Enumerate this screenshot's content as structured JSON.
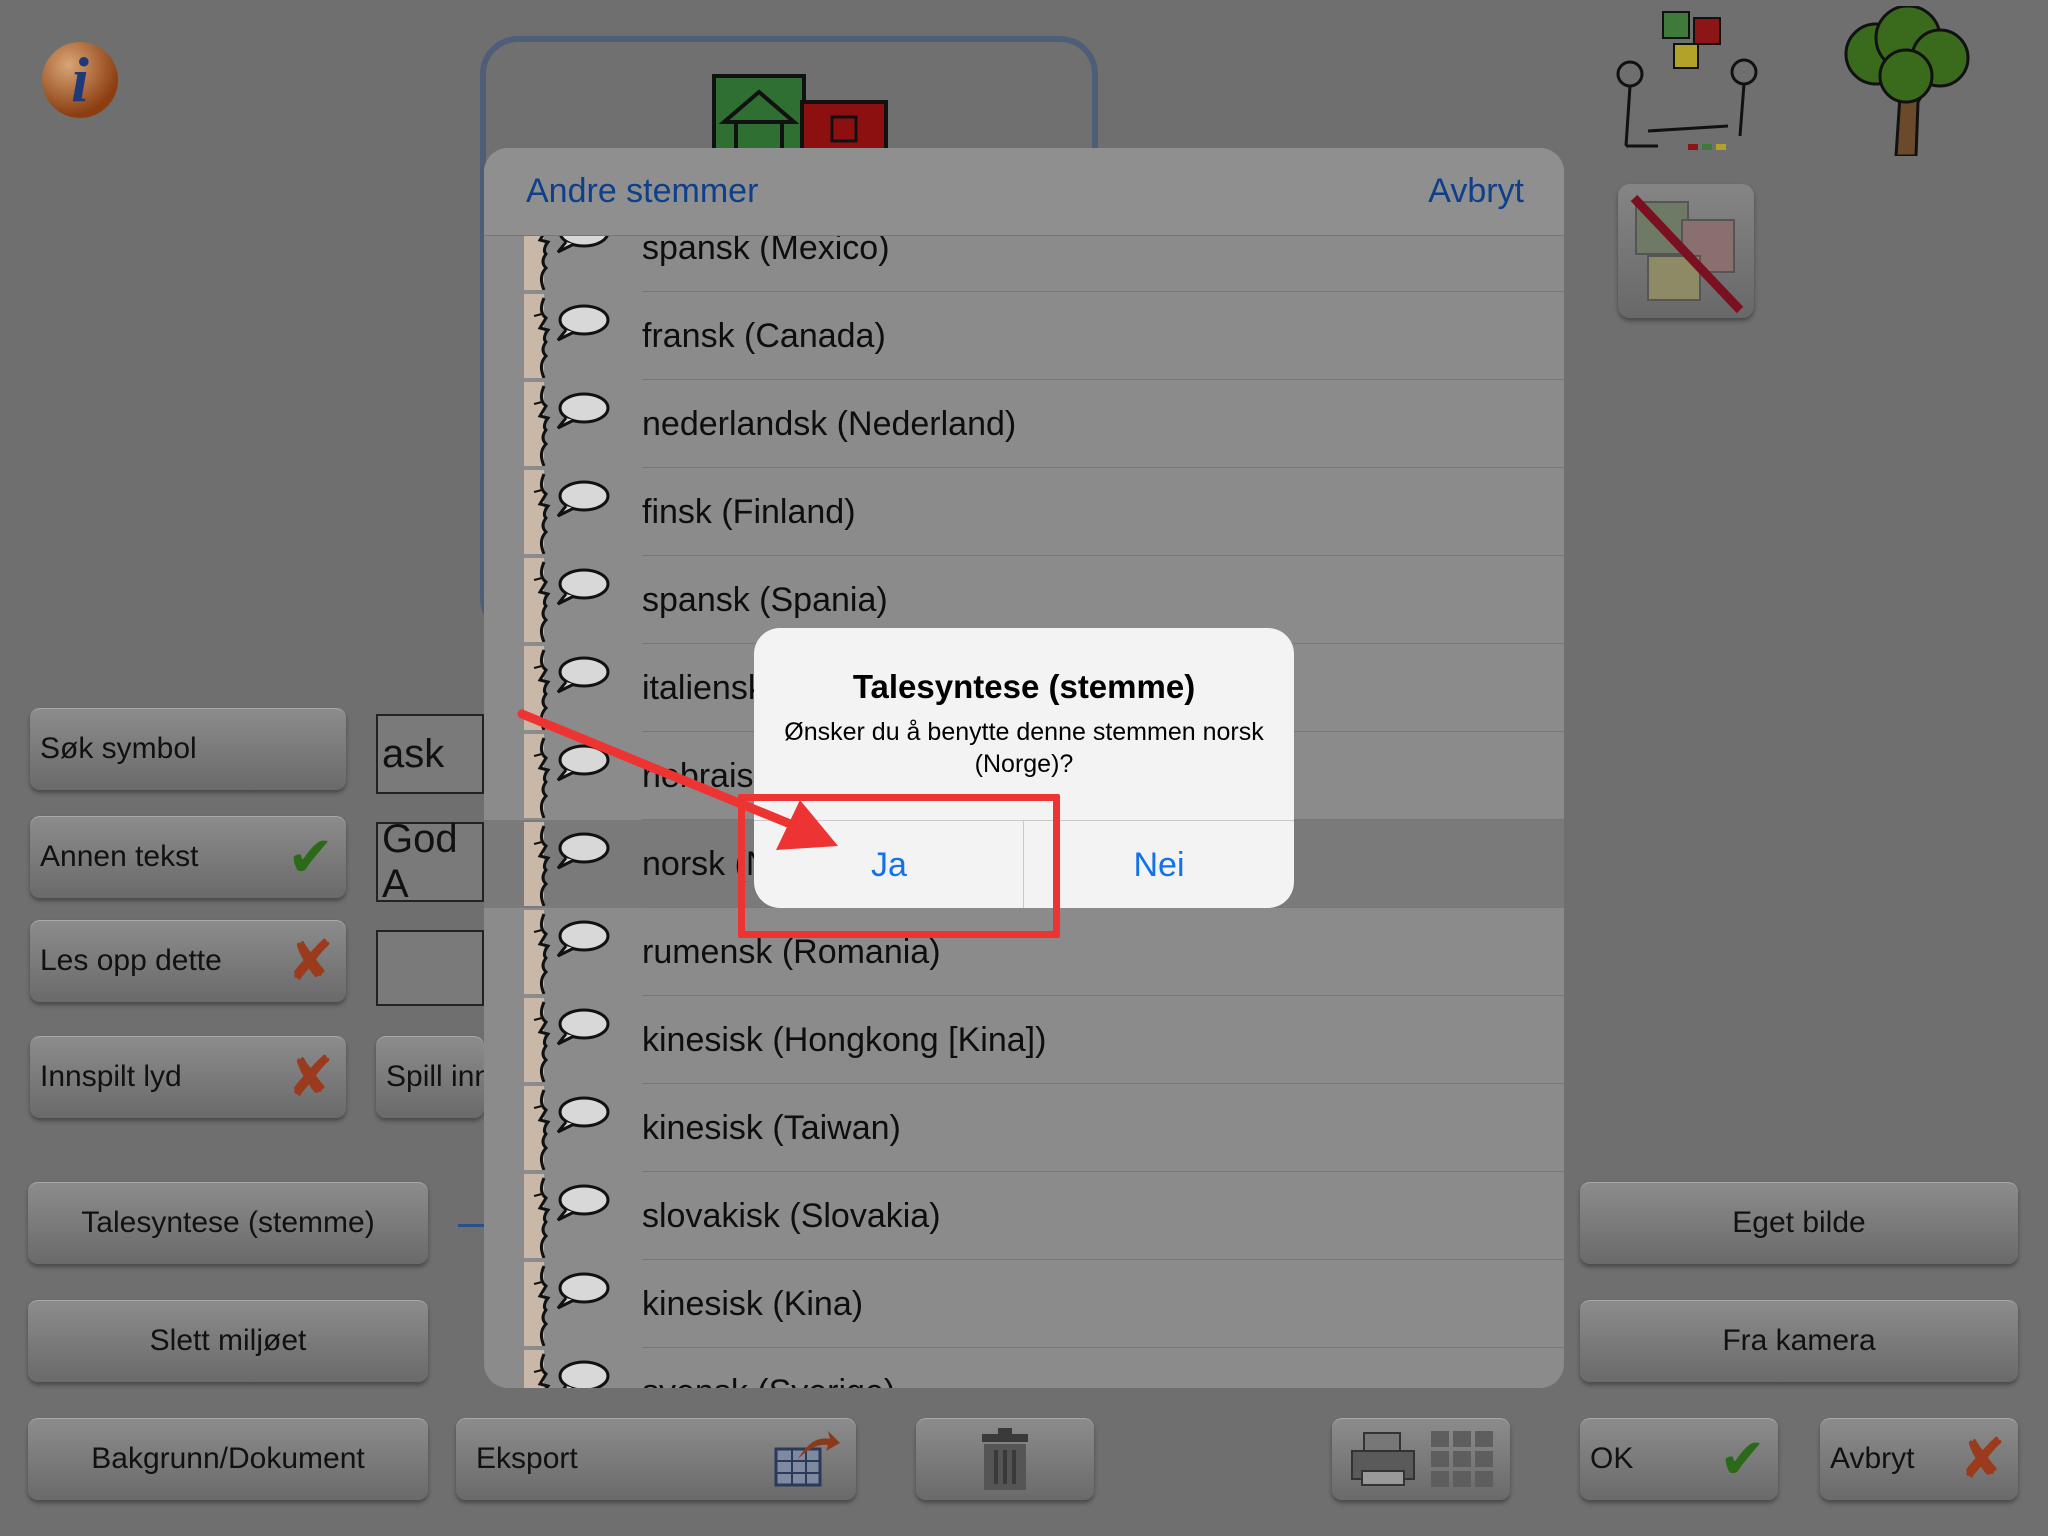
{
  "background_app": {
    "left_buttons": {
      "search_symbol": "Søk symbol",
      "other_text": "Annen tekst",
      "read_aloud": "Les opp dette",
      "recorded_sound": "Innspilt lyd",
      "speech_synthesis": "Talesyntese (stemme)",
      "delete_environment": "Slett miljøet",
      "background_document": "Bakgrunn/Dokument",
      "export": "Eksport"
    },
    "fields": {
      "search_value": "ask",
      "other_text_value": "God A",
      "play_recorded_partial": "Spill inn"
    },
    "right_buttons": {
      "own_image": "Eget bilde",
      "from_camera": "Fra kamera",
      "ok": "OK",
      "cancel": "Avbryt"
    },
    "icons": {
      "info": "info-icon",
      "house": "house-symbol-icon",
      "people": "people-symbol-icon",
      "tree": "tree-symbol-icon",
      "no_symbol": "no-symbol-icon",
      "trash": "trash-icon",
      "print": "print-icon",
      "grid": "grid-icon",
      "export": "export-icon"
    },
    "info_glyph": "i"
  },
  "voice_sheet": {
    "title_button": "Andre stemmer",
    "cancel_button": "Avbryt",
    "voices": [
      "spansk (Mexico)",
      "fransk (Canada)",
      "nederlandsk (Nederland)",
      "finsk (Finland)",
      "spansk (Spania)",
      "italiensk (Italia)",
      "hebraisk (Israel)",
      "norsk (Norge)",
      "rumensk (Romania)",
      "kinesisk (Hongkong [Kina])",
      "kinesisk (Taiwan)",
      "slovakisk (Slovakia)",
      "kinesisk (Kina)",
      "svensk (Sverige)"
    ],
    "selected_index": 7
  },
  "alert": {
    "title": "Talesyntese (stemme)",
    "message": "Ønsker du å benytte denne stemmen norsk (Norge)?",
    "confirm": "Ja",
    "decline": "Nei"
  },
  "colors": {
    "accent_blue": "#1372e8",
    "annotation_red": "#ee3333"
  }
}
